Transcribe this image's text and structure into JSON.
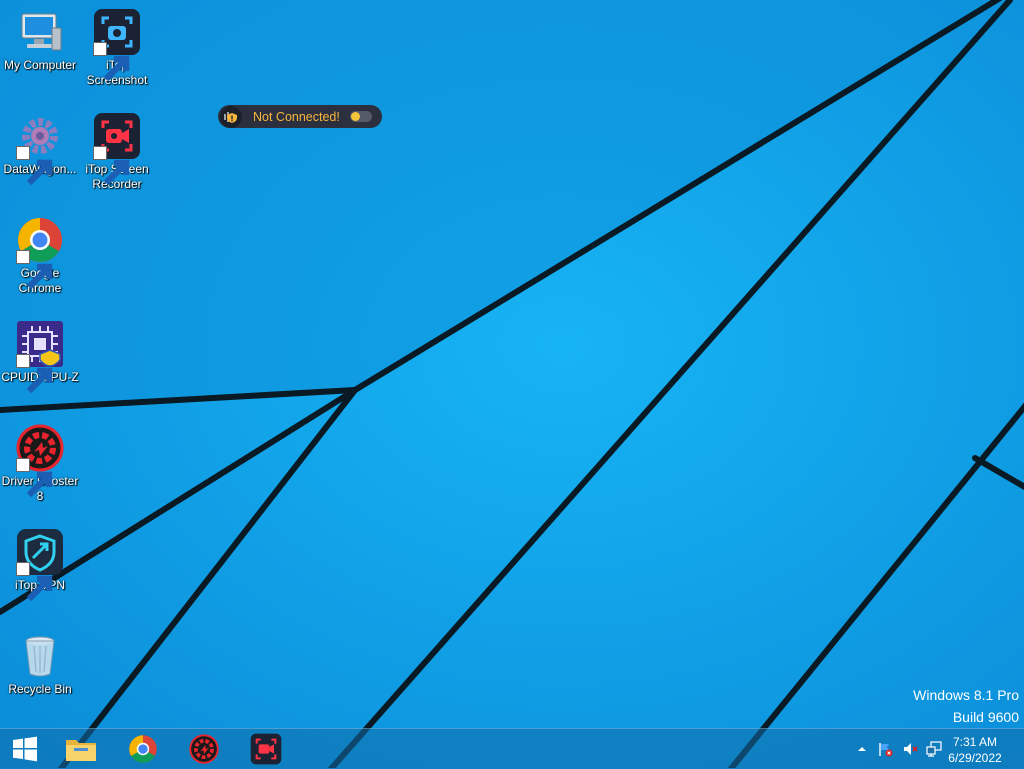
{
  "desktop": {
    "icons": [
      {
        "label": "My Computer"
      },
      {
        "label": "iTop Screenshot"
      },
      {
        "label": "DataWagon..."
      },
      {
        "label": "iTop Screen Recorder"
      },
      {
        "label": "Google Chrome"
      },
      {
        "label": "CPUID CPU-Z"
      },
      {
        "label": "Driver Booster 8"
      },
      {
        "label": "iTop VPN"
      },
      {
        "label": "Recycle Bin"
      }
    ]
  },
  "vpn_widget": {
    "status": "Not Connected!",
    "toggle_on": false
  },
  "watermark": {
    "os": "Windows 8.1 Pro",
    "build": "Build 9600"
  },
  "taskbar": {
    "clock_time": "7:31 AM",
    "clock_date": "6/29/2022"
  },
  "colors": {
    "wallpaper": "#0aa0ec",
    "vpn_text": "#f6b73c",
    "pill_bg": "#2b2f3e"
  }
}
